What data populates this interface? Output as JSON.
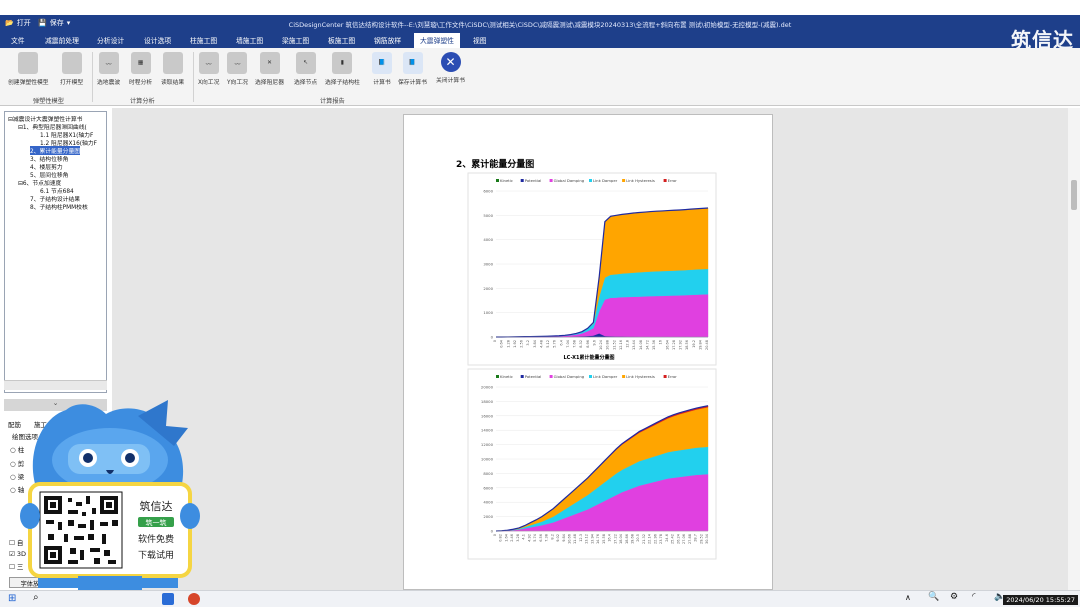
{
  "quick_access": {
    "open_label": "打开",
    "save_label": "保存"
  },
  "window_title": "CiSDesignCenter 筑信达结构设计软件--E:\\刘慧璇\\工作文件\\CiSDC\\测试相关\\CiSDC\\减隔震测试\\减震模块20240313\\全流程+斜向布置 测试\\初始模型-无控模型-(减震).det",
  "brand": "筑信达",
  "menu": [
    {
      "label": "文件"
    },
    {
      "label": "减震前处理"
    },
    {
      "label": "分析设计"
    },
    {
      "label": "设计选项"
    },
    {
      "label": "柱施工图"
    },
    {
      "label": "墙施工图"
    },
    {
      "label": "梁施工图"
    },
    {
      "label": "板施工图"
    },
    {
      "label": "钢筋放样"
    },
    {
      "label": "大震弹塑性"
    },
    {
      "label": "视图"
    }
  ],
  "ribbon": {
    "buttons": [
      {
        "label": "创建弹塑性模型"
      },
      {
        "label": "打开模型"
      },
      {
        "label": "选地震波"
      },
      {
        "label": "时程分析"
      },
      {
        "label": "读取结果"
      },
      {
        "label": "X向工况"
      },
      {
        "label": "Y向工况"
      },
      {
        "label": "选择阻尼器"
      },
      {
        "label": "选择节点"
      },
      {
        "label": "选择子结构柱"
      },
      {
        "label": "计算书"
      },
      {
        "label": "保存计算书"
      },
      {
        "label": "关闭计算书"
      }
    ],
    "groups": [
      {
        "label": "弹塑性模型"
      },
      {
        "label": "计算分析"
      },
      {
        "label": "计算报告"
      }
    ]
  },
  "tree": [
    {
      "label": "减震设计大震弹塑性计算书",
      "sign": "⊟"
    },
    {
      "label": "1、典型阻尼器滞回曲线(",
      "sign": "⊟"
    },
    {
      "label": "1.1 阻尼器X1(轴力F",
      "sign": ""
    },
    {
      "label": "1.2 阻尼器X16(轴力F",
      "sign": ""
    },
    {
      "label": "2、累计能量分量图",
      "sign": ""
    },
    {
      "label": "3、结构位移角",
      "sign": ""
    },
    {
      "label": "4、楼层剪力",
      "sign": ""
    },
    {
      "label": "5、层间位移角",
      "sign": ""
    },
    {
      "label": "6、节点加速度",
      "sign": "⊟"
    },
    {
      "label": "6.1 节点684",
      "sign": ""
    },
    {
      "label": "7、子结构设计结果",
      "sign": ""
    },
    {
      "label": "8、子结构柱PMM校核",
      "sign": ""
    }
  ],
  "lower_panel": {
    "tabs": [
      {
        "label": "配筋"
      },
      {
        "label": "施工"
      }
    ],
    "section_title": "绘图选项",
    "options": [
      {
        "label": "柱"
      },
      {
        "label": "剪"
      },
      {
        "label": "梁"
      },
      {
        "label": "轴"
      }
    ],
    "checkboxes": [
      {
        "label": "自",
        "checked": false
      },
      {
        "label": "3D",
        "checked": true
      },
      {
        "label": "三",
        "checked": false
      }
    ],
    "font_button": "字体放大"
  },
  "promo": {
    "brand": "筑信达",
    "tag": "筑一筑",
    "line1": "软件免费",
    "line2": "下载试用"
  },
  "document": {
    "heading": "2、累计能量分量图",
    "legend": [
      "Kinetic",
      "Potential",
      "Global Damping",
      "Link Damper",
      "Link Hysteresis",
      "Error"
    ],
    "caption": "LC-X1累计能量分量图"
  },
  "chart_data": [
    {
      "type": "area",
      "title": "",
      "caption": "LC-X1累计能量分量图",
      "ylim": [
        0,
        6000
      ],
      "yticks": [
        0,
        1000,
        2000,
        3000,
        4000,
        5000,
        6000
      ],
      "x": [
        0,
        0.56,
        1.12,
        1.68,
        2.24,
        2.8,
        3.36,
        3.92,
        4.48,
        5.04,
        5.6,
        6.16,
        6.72,
        7.28,
        7.84,
        8.4,
        8.96,
        9.52,
        10.08,
        10.64,
        11.2,
        11.76,
        12.32,
        12.88,
        13.44,
        14,
        14.56,
        15.12,
        15.68,
        16.24,
        16.8,
        17.36,
        17.92,
        18.48,
        19.04,
        19.6,
        20.16,
        20.72
      ],
      "xtick_labels": [
        "0",
        "0.64",
        "1.28",
        "1.92",
        "2.56",
        "3.2",
        "3.84",
        "4.48",
        "5.12",
        "5.76",
        "6.4",
        "7.04",
        "7.68",
        "8.32",
        "8.96",
        "9.6",
        "10.24",
        "10.88",
        "11.52",
        "12.16",
        "12.8",
        "13.44",
        "14.08",
        "14.72",
        "15.36",
        "16",
        "16.64",
        "17.28",
        "17.92",
        "18.56",
        "19.2",
        "19.84",
        "20.48"
      ],
      "series": [
        {
          "name": "Kinetic",
          "color": "#1a7a1a",
          "values": [
            0,
            0,
            0,
            0,
            0,
            0,
            0,
            0,
            0,
            0,
            0,
            0,
            0,
            0,
            0,
            0,
            0,
            0,
            0,
            0,
            0,
            0,
            0,
            0,
            0,
            0,
            0,
            0,
            0,
            0,
            0,
            0,
            0,
            0,
            0,
            0,
            0,
            0
          ]
        },
        {
          "name": "Potential",
          "color": "#1f2aa0",
          "values": [
            0,
            0,
            0,
            0,
            0,
            0,
            0,
            0,
            0,
            0,
            5,
            5,
            10,
            10,
            20,
            30,
            40,
            60,
            150,
            40,
            30,
            20,
            20,
            15,
            15,
            10,
            10,
            10,
            10,
            10,
            10,
            10,
            10,
            10,
            10,
            10,
            10,
            10
          ]
        },
        {
          "name": "Global Damping",
          "color": "#e040e0",
          "values": [
            0,
            0,
            2,
            5,
            8,
            10,
            12,
            15,
            18,
            22,
            25,
            30,
            40,
            60,
            80,
            120,
            200,
            300,
            900,
            1500,
            1580,
            1600,
            1620,
            1630,
            1640,
            1650,
            1660,
            1670,
            1675,
            1680,
            1690,
            1695,
            1700,
            1710,
            1720,
            1730,
            1740,
            1745
          ]
        },
        {
          "name": "Link Damper",
          "color": "#22d0ee",
          "values": [
            0,
            0,
            0,
            2,
            3,
            4,
            5,
            6,
            8,
            10,
            12,
            15,
            20,
            30,
            40,
            60,
            100,
            200,
            600,
            900,
            950,
            960,
            970,
            980,
            990,
            1000,
            1005,
            1010,
            1015,
            1020,
            1020,
            1025,
            1030,
            1030,
            1035,
            1040,
            1040,
            1045
          ]
        },
        {
          "name": "Link Hysteresis",
          "color": "#ffa500",
          "values": [
            0,
            0,
            0,
            0,
            0,
            0,
            0,
            0,
            0,
            0,
            0,
            0,
            0,
            0,
            5,
            10,
            20,
            40,
            800,
            2300,
            2400,
            2420,
            2430,
            2440,
            2450,
            2455,
            2460,
            2465,
            2470,
            2470,
            2475,
            2480,
            2480,
            2485,
            2490,
            2490,
            2495,
            2500
          ]
        },
        {
          "name": "Error",
          "color": "#d41f1f",
          "values": [
            0,
            0,
            0,
            0,
            0,
            0,
            0,
            0,
            0,
            0,
            0,
            0,
            0,
            0,
            0,
            0,
            0,
            0,
            0,
            0,
            0,
            0,
            0,
            0,
            0,
            0,
            0,
            0,
            0,
            0,
            0,
            0,
            0,
            0,
            0,
            0,
            0,
            0
          ]
        }
      ]
    },
    {
      "type": "area",
      "title": "",
      "ylim": [
        0,
        20000
      ],
      "yticks": [
        0,
        2000,
        4000,
        6000,
        8000,
        10000,
        12000,
        14000,
        16000,
        18000,
        20000
      ],
      "x": [
        0,
        0.82,
        1.64,
        2.46,
        3.28,
        4.1,
        4.92,
        5.74,
        6.56,
        7.38,
        8.2,
        9.02,
        9.84,
        10.66,
        11.48,
        12.3,
        13.12,
        13.94,
        14.76,
        15.58,
        16.4,
        17.22,
        18.04,
        18.86,
        19.68,
        20.5,
        21.32,
        22.14,
        22.96,
        23.78,
        24.6,
        25.42,
        26.24,
        27.06,
        27.88,
        28.7,
        29.52,
        30.34
      ],
      "xtick_labels": [
        "0",
        "0.82",
        "1.64",
        "2.46",
        "3.28",
        "4.1",
        "4.92",
        "5.74",
        "6.56",
        "7.38",
        "8.2",
        "9.02",
        "9.84",
        "10.66",
        "11.48",
        "12.3",
        "13.12",
        "13.94",
        "14.76",
        "15.58",
        "16.4",
        "17.22",
        "18.04",
        "18.86",
        "19.68",
        "20.5",
        "21.32",
        "22.14",
        "22.96",
        "23.78",
        "24.6",
        "25.42",
        "26.24",
        "27.06",
        "27.88",
        "28.7",
        "29.52",
        "30.34"
      ],
      "series": [
        {
          "name": "Kinetic",
          "color": "#1a7a1a",
          "values": [
            0,
            0,
            0,
            0,
            0,
            0,
            0,
            0,
            0,
            0,
            0,
            0,
            0,
            0,
            0,
            0,
            0,
            0,
            0,
            0,
            0,
            0,
            0,
            0,
            0,
            0,
            0,
            0,
            0,
            0,
            0,
            0,
            0,
            0,
            0,
            0,
            0,
            0
          ]
        },
        {
          "name": "Potential",
          "color": "#1f2aa0",
          "values": [
            0,
            0,
            0,
            0,
            0,
            0,
            0,
            0,
            0,
            0,
            0,
            0,
            0,
            0,
            0,
            0,
            0,
            0,
            0,
            0,
            0,
            0,
            0,
            0,
            0,
            0,
            0,
            0,
            0,
            0,
            0,
            0,
            0,
            0,
            0,
            0,
            0,
            0
          ]
        },
        {
          "name": "Global Damping",
          "color": "#e040e0",
          "values": [
            0,
            20,
            50,
            120,
            200,
            350,
            500,
            650,
            800,
            1000,
            1200,
            1500,
            1800,
            2100,
            2400,
            2700,
            3000,
            3400,
            3800,
            4200,
            4600,
            5000,
            5400,
            5700,
            6000,
            6300,
            6500,
            6700,
            6900,
            7100,
            7300,
            7400,
            7500,
            7600,
            7700,
            7800,
            7850,
            7900
          ]
        },
        {
          "name": "Link Damper",
          "color": "#22d0ee",
          "values": [
            0,
            10,
            30,
            60,
            100,
            200,
            300,
            400,
            500,
            650,
            800,
            1000,
            1200,
            1400,
            1600,
            1800,
            2000,
            2200,
            2400,
            2600,
            2800,
            3000,
            3100,
            3200,
            3300,
            3400,
            3450,
            3500,
            3550,
            3600,
            3650,
            3700,
            3720,
            3740,
            3760,
            3780,
            3790,
            3800
          ]
        },
        {
          "name": "Link Hysteresis",
          "color": "#ffa500",
          "values": [
            0,
            10,
            30,
            60,
            120,
            200,
            350,
            500,
            700,
            900,
            1100,
            1300,
            1500,
            1700,
            1900,
            2100,
            2300,
            2500,
            2700,
            2900,
            3100,
            3300,
            3500,
            3650,
            3800,
            3950,
            4100,
            4250,
            4400,
            4550,
            4700,
            4850,
            5000,
            5100,
            5200,
            5300,
            5400,
            5500
          ]
        },
        {
          "name": "Error",
          "color": "#d41f1f",
          "values": [
            0,
            0,
            0,
            0,
            0,
            0,
            0,
            0,
            0,
            0,
            10,
            20,
            30,
            40,
            50,
            60,
            70,
            80,
            90,
            100,
            110,
            120,
            130,
            140,
            150,
            160,
            170,
            180,
            190,
            200,
            200,
            200,
            200,
            200,
            200,
            200,
            200,
            200
          ]
        }
      ]
    }
  ],
  "taskbar": {
    "datetime": "2024/06/20 15:55:27"
  }
}
